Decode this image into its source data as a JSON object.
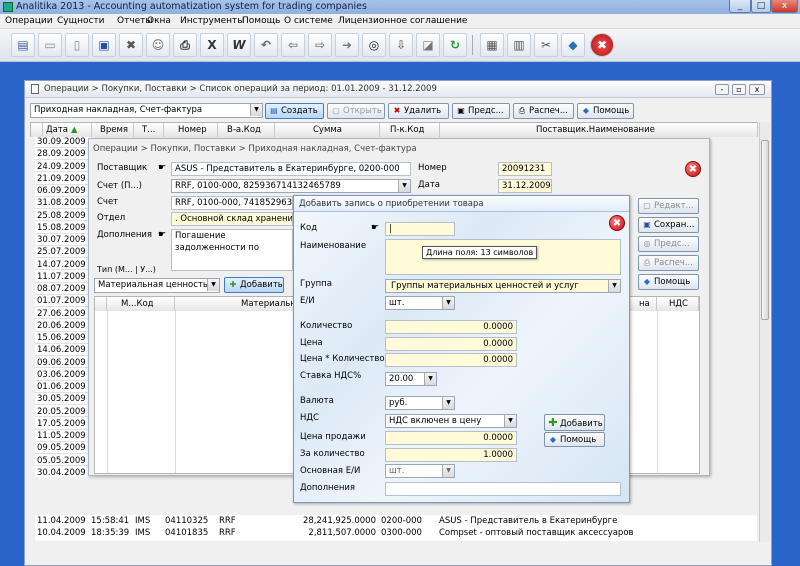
{
  "window": {
    "title": "Analitika 2013 - Accounting automatization system for trading companies",
    "min": "_",
    "max": "□",
    "close": "x"
  },
  "menu": [
    "Операции",
    "Сущности",
    "Отчеты",
    "Окна",
    "Инструменты",
    "Помощь",
    "О системе",
    "Лицензионное соглашение"
  ],
  "toolbar": [
    "open-card-icon",
    "folder-icon",
    "new-doc-icon",
    "save-icon",
    "delete-icon",
    "user-icon",
    "print-icon",
    "excel-icon",
    "word-icon",
    "undo-icon",
    "arrow-left-icon",
    "arrow-right-icon",
    "arrow-forward-icon",
    "binoculars-icon",
    "arrow-down-icon",
    "ruler-icon",
    "refresh-icon",
    "calendar-icon",
    "calculator-icon",
    "tools-icon",
    "help-book-icon",
    "close-icon"
  ],
  "toolbar_glyphs": [
    "▤",
    "▭",
    "▯",
    "▣",
    "✖",
    "☺",
    "⎙",
    "X",
    "W",
    "↶",
    "⇦",
    "⇨",
    "➜",
    "◎",
    "⇩",
    "◪",
    "↻",
    "▦",
    "▥",
    "✂",
    "◆",
    "✖"
  ],
  "main": {
    "breadcrumb": "Операции > Покупки, Поставки > Список операций за период: 01.01.2009 - 31.12.2009",
    "type_select": "Приходная накладная, Счет-фактура",
    "buttons": {
      "create": "Создать",
      "open": "Открыть",
      "delete": "Удалить",
      "prev": "Предс...",
      "print": "Распеч...",
      "help": "Помощь"
    },
    "columns": [
      "Дата",
      "Время",
      "Т...",
      "Номер",
      "В-а.Код",
      "Сумма",
      "П-к.Код",
      "Поставщик.Наименование"
    ],
    "dates": [
      "30.09.2009",
      "28.09.2009",
      "24.09.2009",
      "21.09.2009",
      "06.09.2009",
      "31.08.2009",
      "25.08.2009",
      "15.08.2009",
      "30.07.2009",
      "25.07.2009",
      "14.07.2009",
      "11.07.2009",
      "08.07.2009",
      "01.07.2009",
      "27.06.2009",
      "20.06.2009",
      "15.06.2009",
      "14.06.2009",
      "09.06.2009",
      "03.06.2009",
      "01.06.2009",
      "30.05.2009",
      "20.05.2009",
      "17.05.2009",
      "11.05.2009",
      "09.05.2009",
      "05.05.2009",
      "30.04.2009",
      "25.04.2009",
      "20.04.2009",
      "17.04.2009"
    ],
    "rows": [
      {
        "date": "11.04.2009",
        "time": "15:58:41",
        "type": "IMS",
        "number": "04110325",
        "currency": "RRF",
        "sum": "28,241,925.0000",
        "supplier_code": "0200-000",
        "supplier": "ASUS - Представитель в Екатеринбурге"
      },
      {
        "date": "10.04.2009",
        "time": "18:35:39",
        "type": "IMS",
        "number": "04101835",
        "currency": "RRF",
        "sum": "2,811,507.0000",
        "supplier_code": "0300-000",
        "supplier": "Compset - оптовый поставщик аксессуаров"
      }
    ]
  },
  "invoice": {
    "breadcrumb": "Операции > Покупки, Поставки > Приходная накладная, Счет-фактура",
    "labels": {
      "supplier": "Поставщик",
      "account_p": "Счет (П...)",
      "account": "Счет",
      "department": "Отдел",
      "additions": "Дополнения",
      "number": "Номер",
      "date": "Дата",
      "type": "Тип (М... | У...)"
    },
    "supplier": "ASUS - Представитель в Екатеринбурге, 0200-000",
    "account_p": "RRF, 0100-000, 825936714132465789",
    "account": "RRF, 0100-000, 741852963123",
    "department": ". Основной склад хранения",
    "additions": "Погашение задолженности по",
    "number": "20091231",
    "date": "31.12.2009",
    "type_value": "Материальная ценность",
    "add_button": "Добавить",
    "columns": [
      "М...Код",
      "Материальная",
      "на",
      "НДС"
    ],
    "side_buttons": {
      "edit": "Редакт...",
      "save": "Сохран...",
      "prev": "Предс...",
      "print": "Распеч...",
      "help": "Помощь"
    }
  },
  "add_record": {
    "title": "Добавить запись о приобретении товара",
    "labels": {
      "code": "Код",
      "name": "Наименование",
      "group": "Группа",
      "unit": "Е/И",
      "quantity": "Количество",
      "price": "Цена",
      "price_qty": "Цена * Количество",
      "vat_rate": "Ставка НДС%",
      "currency": "Валюта",
      "vat": "НДС",
      "sale_price": "Цена продажи",
      "per_quantity": "За количество",
      "base_unit": "Основная Е/И",
      "additions": "Дополнения"
    },
    "code": "|",
    "tooltip": "Длина поля: 13 символов",
    "group": "Группы материальных ценностей и услуг",
    "unit": "шт.",
    "quantity": "0.0000",
    "price": "0.0000",
    "price_qty": "0.0000",
    "vat_rate": "20.00",
    "currency": "руб.",
    "vat": "НДС включен в цену",
    "sale_price": "0.0000",
    "per_quantity": "1.0000",
    "base_unit": "шт.",
    "add_button": "Добавить",
    "help_button": "Помощь"
  }
}
